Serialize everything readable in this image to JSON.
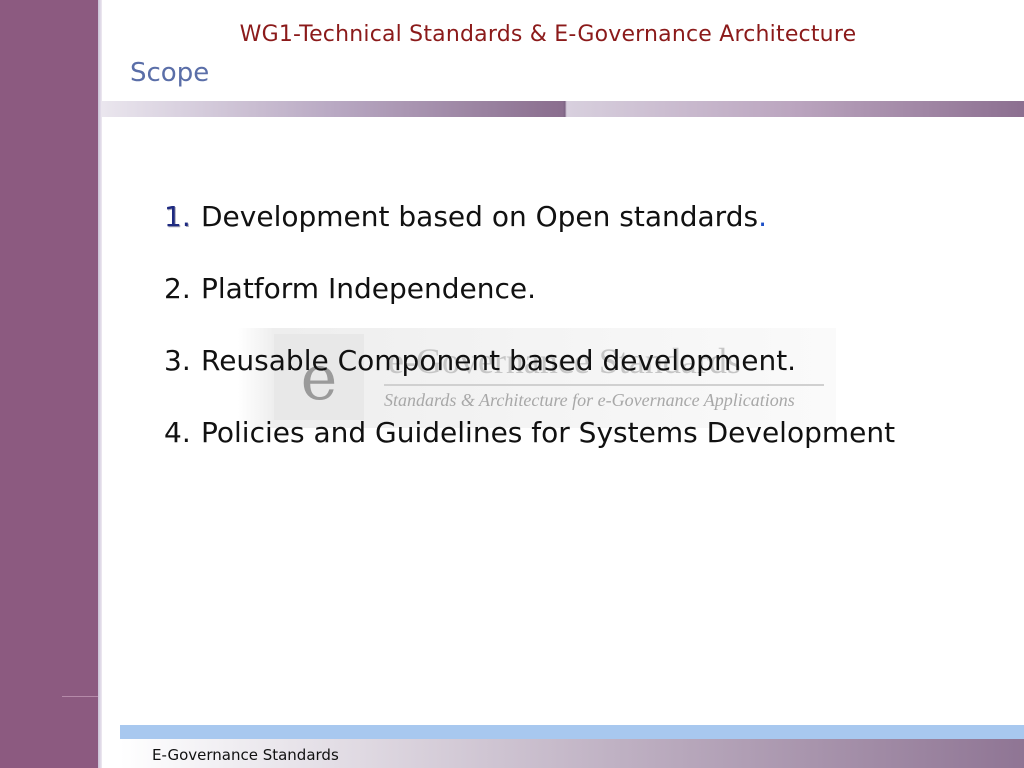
{
  "header": {
    "title": "WG1-Technical Standards & E-Governance Architecture",
    "slide_title": "Scope"
  },
  "watermark": {
    "letter": "e",
    "title": "e-Governance Standards",
    "subtitle": "Standards & Architecture for e-Governance Applications"
  },
  "scope_items": [
    {
      "number": "1.",
      "text": "Development based on Open standards",
      "trailing": "."
    },
    {
      "number": "2.",
      "text": "Platform Independence."
    },
    {
      "number": "3.",
      "text": "Reusable Component based development."
    },
    {
      "number": "4.",
      "text": "Policies and Guidelines for Systems Development"
    }
  ],
  "footer": {
    "text": "E-Governance Standards"
  },
  "colors": {
    "left_bar": "#8c5a80",
    "header_title": "#8b1a1a",
    "slide_title": "#5a6ea8",
    "footer_stripe": "#a8c8ef"
  }
}
